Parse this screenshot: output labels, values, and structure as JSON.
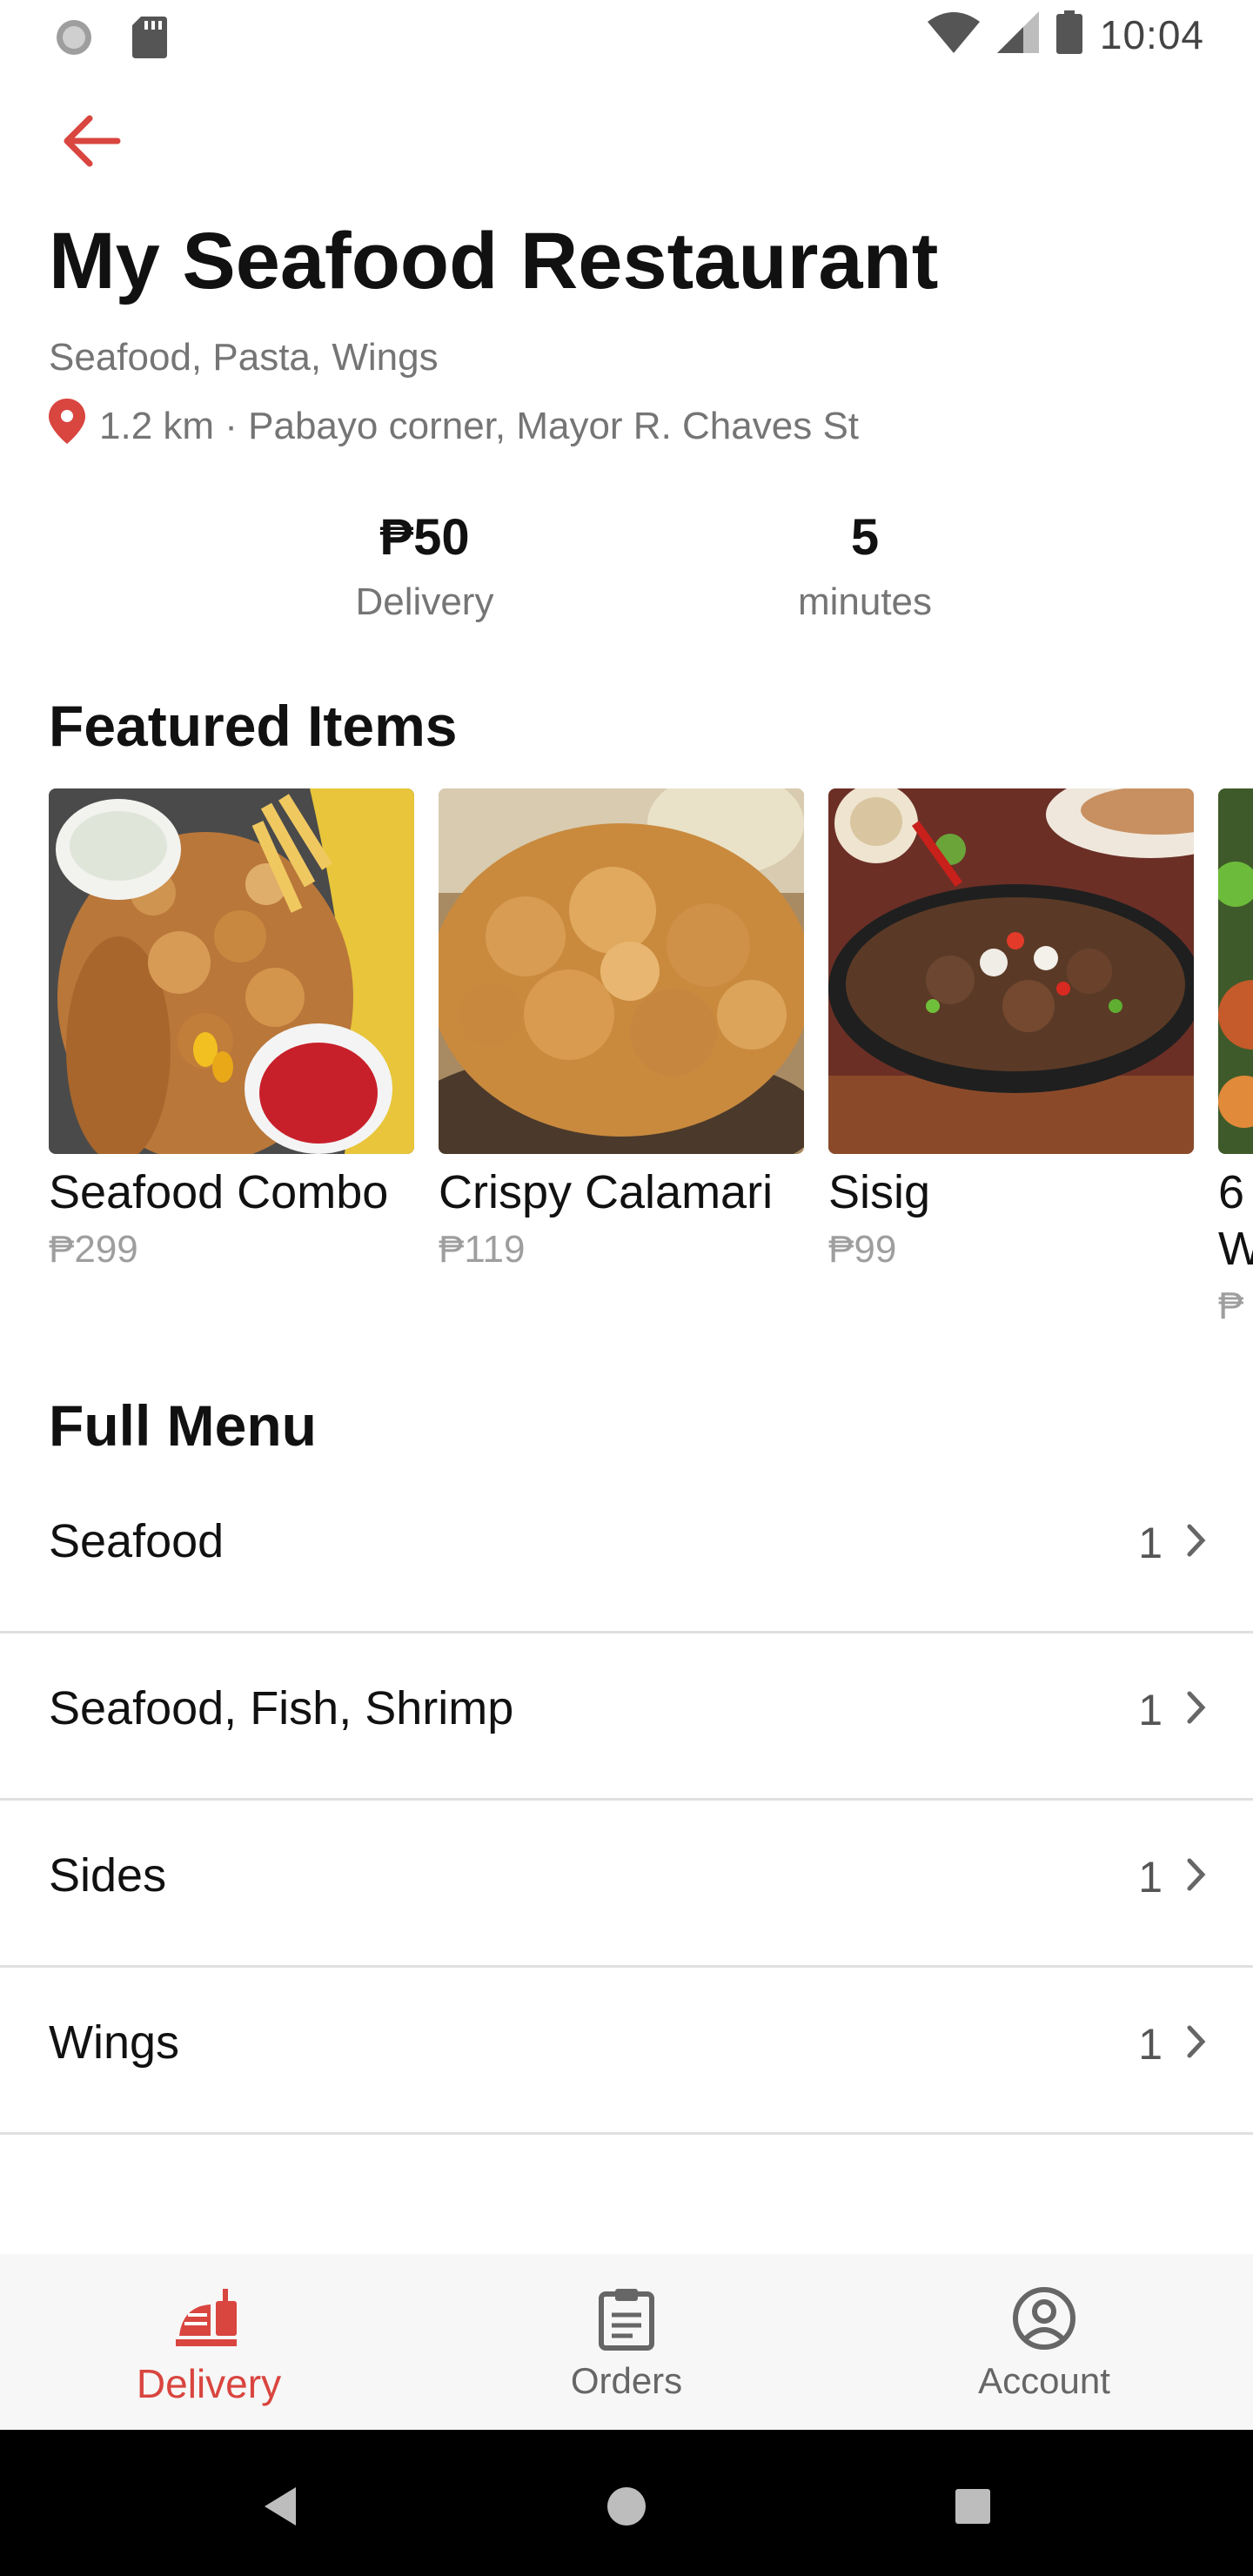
{
  "status_bar": {
    "time": "10:04",
    "left_icons": [
      "sync-icon",
      "sd-card-icon"
    ],
    "right_icons": [
      "wifi-icon",
      "cell-signal-icon",
      "battery-icon"
    ]
  },
  "header": {
    "back_icon": "arrow-left-icon",
    "title": "My Seafood Restaurant",
    "cuisines": "Seafood, Pasta, Wings",
    "location_icon": "location-pin-icon",
    "address": "1.2 km · Pabayo corner, Mayor R. Chaves St"
  },
  "stats": {
    "delivery_fee": "₱50",
    "delivery_label": "Delivery",
    "time_value": "5",
    "time_label": "minutes"
  },
  "featured": {
    "title": "Featured Items",
    "items": [
      {
        "name": "Seafood Combo",
        "price": "₱299"
      },
      {
        "name": "Crispy Calamari",
        "price": "₱119"
      },
      {
        "name": "Sisig",
        "price": "₱99"
      },
      {
        "name": "6",
        "line2": "W",
        "price": "₱"
      }
    ]
  },
  "menu": {
    "title": "Full Menu",
    "categories": [
      {
        "label": "Seafood",
        "count": "1"
      },
      {
        "label": "Seafood, Fish, Shrimp",
        "count": "1"
      },
      {
        "label": "Sides",
        "count": "1"
      },
      {
        "label": "Wings",
        "count": "1"
      }
    ]
  },
  "bottom_nav": {
    "items": [
      {
        "label": "Delivery",
        "icon": "delivery-icon",
        "active": true
      },
      {
        "label": "Orders",
        "icon": "clipboard-icon",
        "active": false
      },
      {
        "label": "Account",
        "icon": "account-circle-icon",
        "active": false
      }
    ]
  },
  "colors": {
    "accent": "#d9453f",
    "text_primary": "#111111",
    "text_secondary": "#757575",
    "price": "#9e9e9e"
  }
}
